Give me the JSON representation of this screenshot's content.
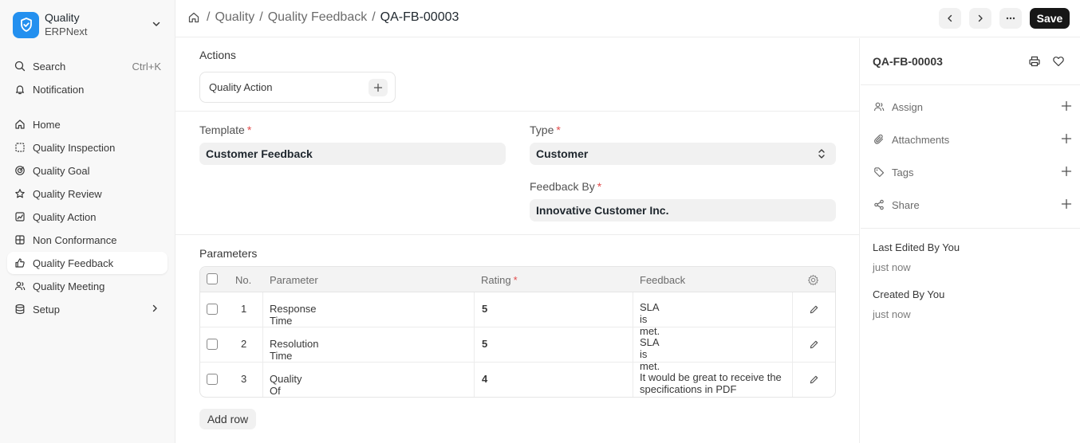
{
  "app": {
    "title": "Quality",
    "subtitle": "ERPNext"
  },
  "sidebar": {
    "search": {
      "label": "Search",
      "shortcut": "Ctrl+K",
      "icon": "search-icon"
    },
    "notification": {
      "label": "Notification",
      "icon": "bell-icon"
    },
    "items": [
      {
        "label": "Home",
        "icon": "home-icon"
      },
      {
        "label": "Quality Inspection",
        "icon": "inspection-icon"
      },
      {
        "label": "Quality Goal",
        "icon": "goal-icon"
      },
      {
        "label": "Quality Review",
        "icon": "star-icon"
      },
      {
        "label": "Quality Action",
        "icon": "chart-icon"
      },
      {
        "label": "Non Conformance",
        "icon": "grid-icon"
      },
      {
        "label": "Quality Feedback",
        "icon": "thumbs-up-icon",
        "active": true
      },
      {
        "label": "Quality Meeting",
        "icon": "users-icon"
      },
      {
        "label": "Setup",
        "icon": "database-icon"
      }
    ]
  },
  "header": {
    "breadcrumbs": [
      "Quality",
      "Quality Feedback"
    ],
    "current": "QA-FB-00003",
    "save_label": "Save"
  },
  "form": {
    "actions_label": "Actions",
    "quality_action_label": "Quality Action",
    "template": {
      "label": "Template",
      "value": "Customer Feedback"
    },
    "type": {
      "label": "Type",
      "value": "Customer"
    },
    "feedback_by": {
      "label": "Feedback By",
      "value": "Innovative Customer Inc."
    },
    "parameters_label": "Parameters",
    "grid": {
      "columns": [
        "No.",
        "Parameter",
        "Rating",
        "Feedback"
      ],
      "rows": [
        {
          "no": "1",
          "parameter": "Response Time",
          "rating": "5",
          "feedback": "SLA is met."
        },
        {
          "no": "2",
          "parameter": "Resolution Time",
          "rating": "5",
          "feedback": "SLA is met."
        },
        {
          "no": "3",
          "parameter": "Quality Of Support",
          "rating": "4",
          "feedback": "It would be great to receive the specifications in PDF"
        }
      ]
    },
    "add_row_label": "Add row"
  },
  "right_panel": {
    "title": "QA-FB-00003",
    "items": [
      {
        "label": "Assign",
        "icon": "user-assign-icon"
      },
      {
        "label": "Attachments",
        "icon": "paperclip-icon"
      },
      {
        "label": "Tags",
        "icon": "tag-icon"
      },
      {
        "label": "Share",
        "icon": "share-icon"
      }
    ],
    "last_edited": "Last Edited By You",
    "last_edited_time": "just now",
    "created": "Created By You",
    "created_time": "just now"
  },
  "colors": {
    "brand": "#2490ef",
    "primary_button": "#171717",
    "required": "#e24c4c"
  }
}
